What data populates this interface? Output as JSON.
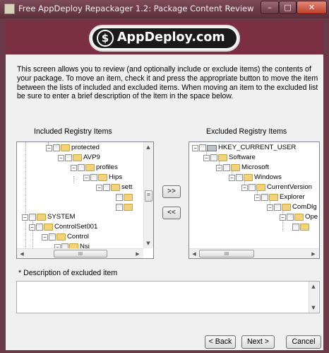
{
  "window": {
    "title": "Free AppDeploy Repackager 1.2: Package Content Review",
    "controls": {
      "minimize": "–",
      "maximize": "□",
      "close": "✕"
    }
  },
  "banner": {
    "logo_text": "AppDeploy.com",
    "logo_mark": "$"
  },
  "description": "This screen allows you to review (and optionally include or exclude items) the contents of your package. To move an item, check it and press the appropriate button to move the item between the lists of included and excluded items. When moving an item to the excluded list be sure to enter a brief description of the item in the space below.",
  "included": {
    "label": "Included Registry Items",
    "nodes": [
      "protected",
      "AVP9",
      "profiles",
      "Hips",
      "sett",
      "",
      "",
      "SYSTEM",
      "ControlSet001",
      "Control",
      "Nsi"
    ],
    "scroll_thumb": "III",
    "vscroll_thumb": "≡"
  },
  "excluded": {
    "label": "Excluded Registry Items",
    "nodes": [
      "HKEY_CURRENT_USER",
      "Software",
      "Microsoft",
      "Windows",
      "CurrentVersion",
      "Explorer",
      "ComDlg",
      "Ope",
      ""
    ],
    "scroll_thumb": "III"
  },
  "move_buttons": {
    "to_excluded": ">>",
    "to_included": "<<"
  },
  "description_field": {
    "label": "* Description of excluded item",
    "value": ""
  },
  "footer": {
    "back": "< Back",
    "next": "Next >",
    "cancel": "Cancel"
  },
  "colors": {
    "titlebar": "#6a3a48",
    "banner": "#7a3042",
    "client": "#f0f0f0"
  }
}
